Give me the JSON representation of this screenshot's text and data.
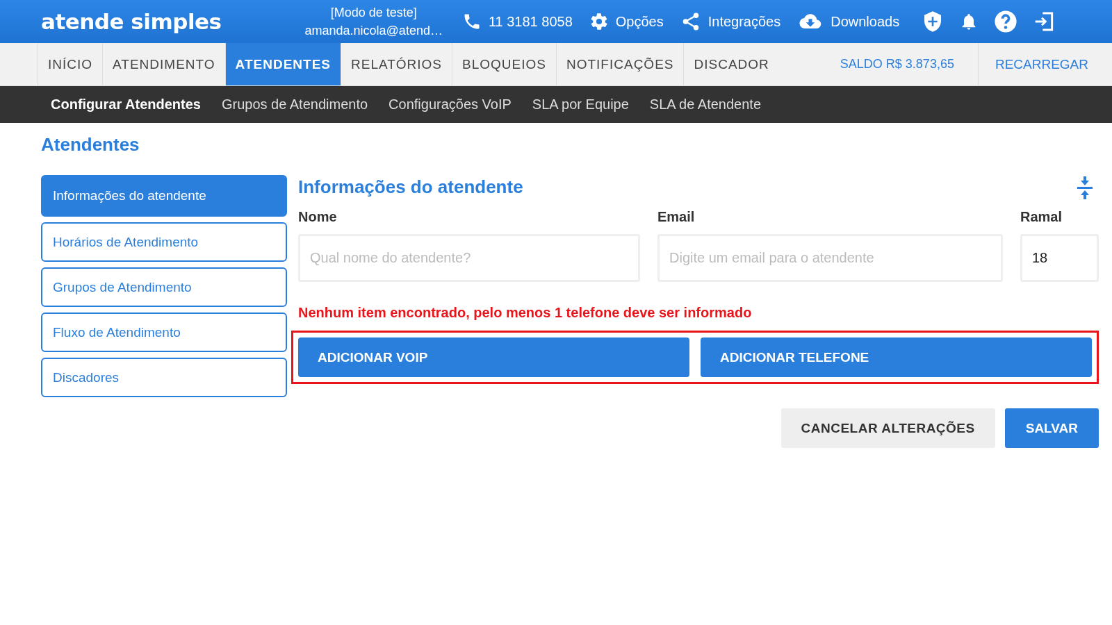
{
  "header": {
    "logo": "atende simples",
    "mode": "[Modo de teste]",
    "user": "amanda.nicola@atend…",
    "links": [
      {
        "kind": "phone",
        "label": "11 3181 8058"
      },
      {
        "kind": "gear",
        "label": "Opções"
      },
      {
        "kind": "share",
        "label": "Integrações"
      },
      {
        "kind": "download",
        "label": "Downloads"
      }
    ],
    "icons": [
      {
        "kind": "shield"
      },
      {
        "kind": "bell"
      },
      {
        "kind": "help"
      },
      {
        "kind": "logout"
      }
    ]
  },
  "nav": {
    "tabs": [
      {
        "label": "INÍCIO",
        "selected": false
      },
      {
        "label": "ATENDIMENTO",
        "selected": false
      },
      {
        "label": "ATENDENTES",
        "selected": true
      },
      {
        "label": "RELATÓRIOS",
        "selected": false
      },
      {
        "label": "BLOQUEIOS",
        "selected": false
      },
      {
        "label": "NOTIFICAÇÕES",
        "selected": false
      },
      {
        "label": "DISCADOR",
        "selected": false
      }
    ],
    "balance": "SALDO R$ 3.873,65",
    "recharge": "RECARREGAR"
  },
  "subnav": [
    {
      "label": "Configurar Atendentes",
      "selected": true
    },
    {
      "label": "Grupos de Atendimento",
      "selected": false
    },
    {
      "label": "Configurações VoIP",
      "selected": false
    },
    {
      "label": "SLA por Equipe",
      "selected": false
    },
    {
      "label": "SLA de Atendente",
      "selected": false
    }
  ],
  "page_title": "Atendentes",
  "sidebar": {
    "items": [
      {
        "label": "Informações do atendente",
        "selected": true
      },
      {
        "label": "Horários de Atendimento",
        "selected": false
      },
      {
        "label": "Grupos de Atendimento",
        "selected": false
      },
      {
        "label": "Fluxo de Atendimento",
        "selected": false
      },
      {
        "label": "Discadores",
        "selected": false
      }
    ]
  },
  "form": {
    "title": "Informações do atendente",
    "fields": [
      {
        "label": "Nome",
        "placeholder": "Qual nome do atendente?"
      },
      {
        "label": "Email",
        "placeholder": "Digite um email para o atendente"
      },
      {
        "label": "Ramal",
        "value": "18"
      }
    ],
    "error": "Nenhum item encontrado, pelo menos 1 telefone deve ser informado",
    "actions": {
      "highlighted": true,
      "buttons": [
        "ADICIONAR VOIP",
        "ADICIONAR TELEFONE"
      ]
    },
    "cancel": "CANCELAR ALTERAÇÕES",
    "save": "SALVAR"
  }
}
